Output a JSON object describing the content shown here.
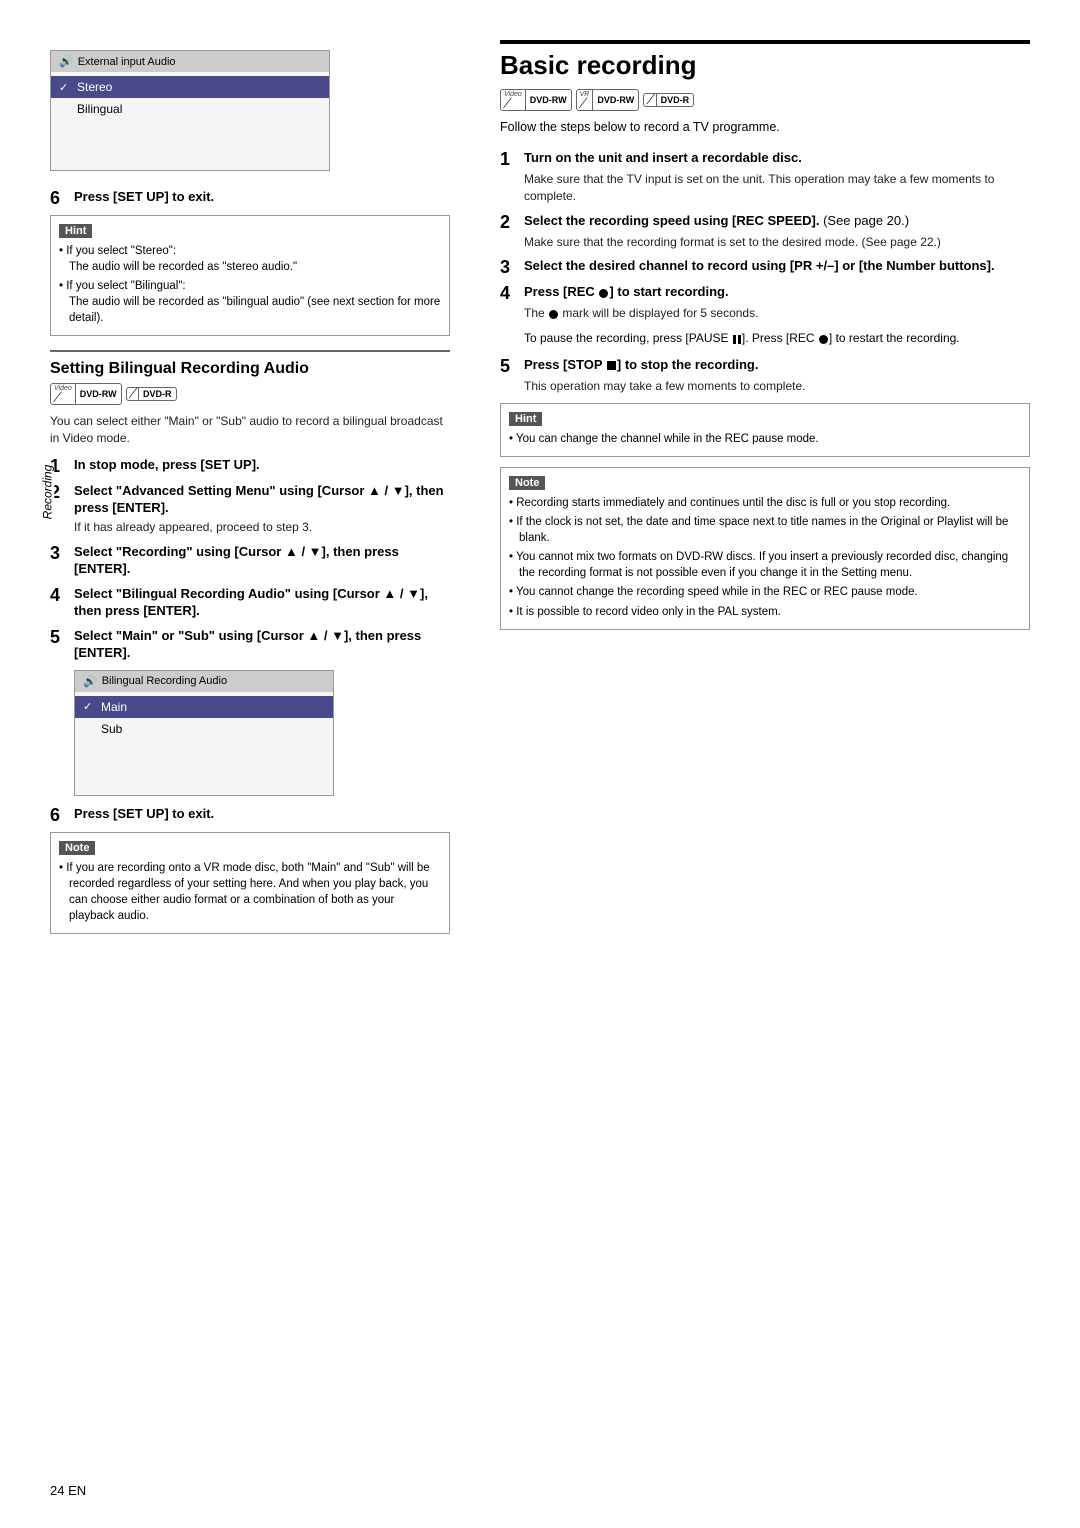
{
  "page": {
    "number": "24",
    "number_suffix": " EN"
  },
  "sidebar_label": "Recording",
  "left": {
    "screen1": {
      "title": "External input Audio",
      "rows": [
        {
          "label": "Stereo",
          "selected": true,
          "checkmark": "✓"
        },
        {
          "label": "Bilingual",
          "selected": false,
          "checkmark": ""
        }
      ]
    },
    "press_setup_1": "Press [SET UP] to exit.",
    "hint1": {
      "label": "Hint",
      "items": [
        "If you select \"Stereo\":\nThe audio will be recorded as \"stereo audio.\"",
        "If you select \"Bilingual\":\nThe audio will be recorded as \"bilingual audio\" (see next section for more detail)."
      ]
    },
    "bilingual_section": {
      "title": "Setting Bilingual Recording Audio",
      "badges": [
        {
          "top": "Video",
          "main": "DVD-RW"
        },
        {
          "top": "",
          "main": "DVD-R"
        }
      ],
      "intro": "You can select either \"Main\" or \"Sub\" audio to record a bilingual broadcast in Video mode.",
      "steps": [
        {
          "num": "1",
          "title": "In stop mode, press [SET UP].",
          "body": ""
        },
        {
          "num": "2",
          "title": "Select \"Advanced Setting Menu\" using [Cursor ▲ / ▼], then press [ENTER].",
          "body": "If it has already appeared, proceed to step 3."
        },
        {
          "num": "3",
          "title": "Select \"Recording\" using [Cursor ▲ / ▼], then press [ENTER].",
          "body": ""
        },
        {
          "num": "4",
          "title": "Select \"Bilingual Recording Audio\" using [Cursor ▲ / ▼], then press [ENTER].",
          "body": ""
        },
        {
          "num": "5",
          "title": "Select \"Main\" or \"Sub\" using [Cursor ▲ / ▼], then press [ENTER].",
          "body": ""
        }
      ],
      "screen2": {
        "title": "Bilingual Recording Audio",
        "rows": [
          {
            "label": "Main",
            "selected": true,
            "checkmark": "✓"
          },
          {
            "label": "Sub",
            "selected": false,
            "checkmark": ""
          }
        ]
      },
      "press_setup_2": "Press [SET UP] to exit.",
      "note1": {
        "label": "Note",
        "items": [
          "If you are recording onto a VR mode disc, both \"Main\" and \"Sub\" will be recorded regardless of your setting here. And when you play back, you can choose either audio format or a combination of both as your playback audio."
        ]
      }
    }
  },
  "right": {
    "title": "Basic recording",
    "badges": [
      {
        "top": "Video",
        "main": "DVD-RW"
      },
      {
        "top": "VR",
        "main": "DVD-RW"
      },
      {
        "top": "",
        "main": "DVD-R"
      }
    ],
    "intro": "Follow the steps below to record a TV programme.",
    "steps": [
      {
        "num": "1",
        "title": "Turn on the unit and insert a recordable disc.",
        "body": "Make sure that the TV input is set on the unit. This operation may take a few moments to complete."
      },
      {
        "num": "2",
        "title": "Select the recording speed using [REC SPEED].",
        "title_note": " (See page 20.)",
        "body": "Make sure that the recording format is set to the desired mode. (See page 22.)"
      },
      {
        "num": "3",
        "title": "Select the desired channel to record using [PR +/–] or [the Number buttons].",
        "body": ""
      },
      {
        "num": "4",
        "title": "Press [REC ●] to start recording.",
        "body": "The ● mark will be displayed for 5 seconds."
      },
      {
        "num": "5",
        "title": "Press [STOP ■] to stop the recording.",
        "body": "This operation may take a few moments to complete."
      }
    ],
    "pause_note": "To pause the recording, press [PAUSE ‖]. Press [REC ●] to restart the recording.",
    "hint2": {
      "label": "Hint",
      "items": [
        "You can change the channel while in the REC pause mode."
      ]
    },
    "note2": {
      "label": "Note",
      "items": [
        "Recording starts immediately and continues until the disc is full or you stop recording.",
        "If the clock is not set, the date and time space next to title names in the Original or Playlist will be blank.",
        "You cannot mix two formats on DVD-RW discs. If you insert a previously recorded disc, changing the recording format is not possible even if you change it in the Setting menu.",
        "You cannot change the recording speed while in the REC or REC pause mode.",
        "It is possible to record video only in the PAL system."
      ]
    }
  }
}
